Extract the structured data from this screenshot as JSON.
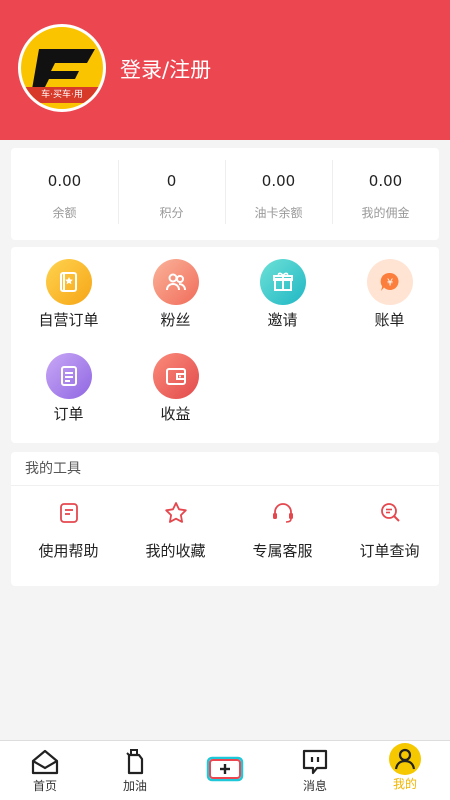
{
  "header": {
    "login_label": "登录/注册",
    "avatar_strip": "车·买车·用"
  },
  "stats": [
    {
      "value": "0.00",
      "label": "余额"
    },
    {
      "value": "0",
      "label": "积分"
    },
    {
      "value": "0.00",
      "label": "油卡余额"
    },
    {
      "value": "0.00",
      "label": "我的佣金"
    }
  ],
  "grid": [
    {
      "label": "自营订单",
      "icon": "self-order-icon",
      "color": "#f9b822"
    },
    {
      "label": "粉丝",
      "icon": "fans-icon",
      "color": "#f58d72"
    },
    {
      "label": "邀请",
      "icon": "gift-icon",
      "color": "#2fc6c4"
    },
    {
      "label": "账单",
      "icon": "yen-bubble-icon",
      "color": "#fb8d4d"
    },
    {
      "label": "订单",
      "icon": "order-icon",
      "color": "#a77ce6"
    },
    {
      "label": "收益",
      "icon": "wallet-icon",
      "color": "#f0605c"
    }
  ],
  "tools": {
    "title": "我的工具",
    "items": [
      {
        "label": "使用帮助",
        "icon": "help-doc-icon"
      },
      {
        "label": "我的收藏",
        "icon": "star-icon"
      },
      {
        "label": "专属客服",
        "icon": "headset-icon"
      },
      {
        "label": "订单查询",
        "icon": "search-doc-icon"
      }
    ]
  },
  "tabbar": [
    {
      "label": "首页",
      "icon": "home-icon"
    },
    {
      "label": "加油",
      "icon": "fuel-icon"
    },
    {
      "label": "",
      "icon": "plus-icon"
    },
    {
      "label": "消息",
      "icon": "message-icon"
    },
    {
      "label": "我的",
      "icon": "user-icon",
      "active": true
    }
  ],
  "colors": {
    "header": "#ec4650",
    "active_tab": "#f0b400",
    "tool_icon": "#e5474e"
  }
}
